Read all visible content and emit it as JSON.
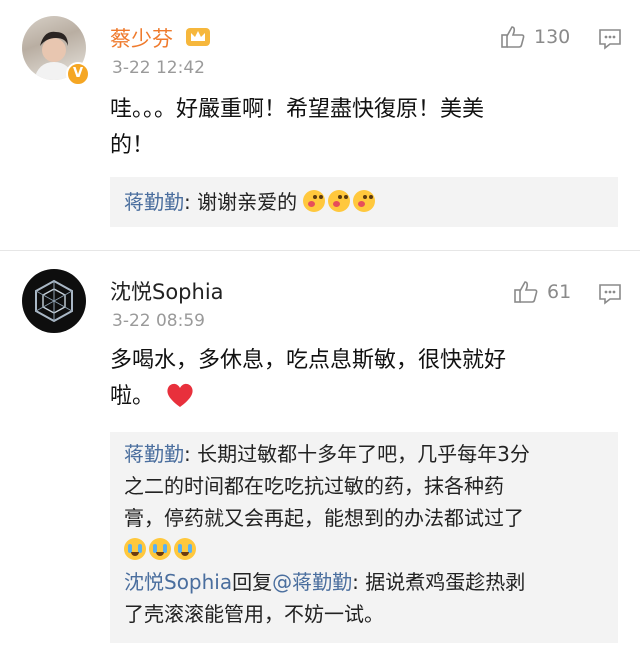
{
  "comments": [
    {
      "user": "蔡少芬",
      "time": "3-22 12:42",
      "likes": "130",
      "text_line1": "哇。。。好嚴重啊！希望盡快復原！美美",
      "text_line2": "的！",
      "replies": [
        {
          "author": "蒋勤勤",
          "sep": ": ",
          "text": "谢谢亲爱的"
        }
      ]
    },
    {
      "user": "沈悦Sophia",
      "time": "3-22 08:59",
      "likes": "61",
      "text_line1": "多喝水，多休息，吃点息斯敏，很快就好",
      "text_line2": "啦。",
      "replies": [
        {
          "author": "蒋勤勤",
          "sep": ": ",
          "line1": "长期过敏都十多年了吧，几乎每年3分",
          "line2": "之二的时间都在吃吃抗过敏的药，抹各种药",
          "line3": "膏，停药就又会再起，能想到的办法都试过了"
        },
        {
          "author": "沈悦Sophia",
          "mid": "回复",
          "mention": "@蒋勤勤",
          "sep": ": ",
          "line1": "据说煮鸡蛋趁热剥",
          "line2": "了壳滚滚能管用，不妨一试。"
        }
      ]
    }
  ],
  "icons": {
    "like": "thumbs-up-icon",
    "comment": "comment-bubble-icon",
    "verified": "verified-v-icon",
    "crown": "crown-icon",
    "heart": "red-heart-icon"
  },
  "colors": {
    "link": "#4a6e9e",
    "name1": "#ef7a2c",
    "verified": "#f5a623",
    "heart": "#e8303c"
  }
}
